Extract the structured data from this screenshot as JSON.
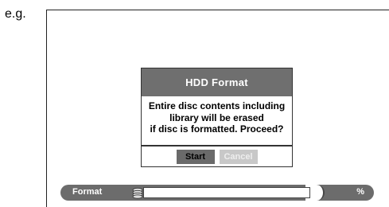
{
  "caption": "e.g.",
  "dialog": {
    "title": "HDD Format",
    "message_lines": [
      "Entire disc contents including",
      "library will be erased",
      "if disc is formatted. Proceed?"
    ],
    "start_label": "Start",
    "cancel_label": "Cancel"
  },
  "progress": {
    "label": "Format",
    "icon": "disc-stack-icon",
    "value_fraction": 0,
    "percent_text": "%"
  },
  "colors": {
    "title_bar": "#6f6f6f",
    "start_button": "#6a6a6a",
    "cancel_button": "#c8c8c8",
    "progress_bar": "#6c6c6c"
  }
}
